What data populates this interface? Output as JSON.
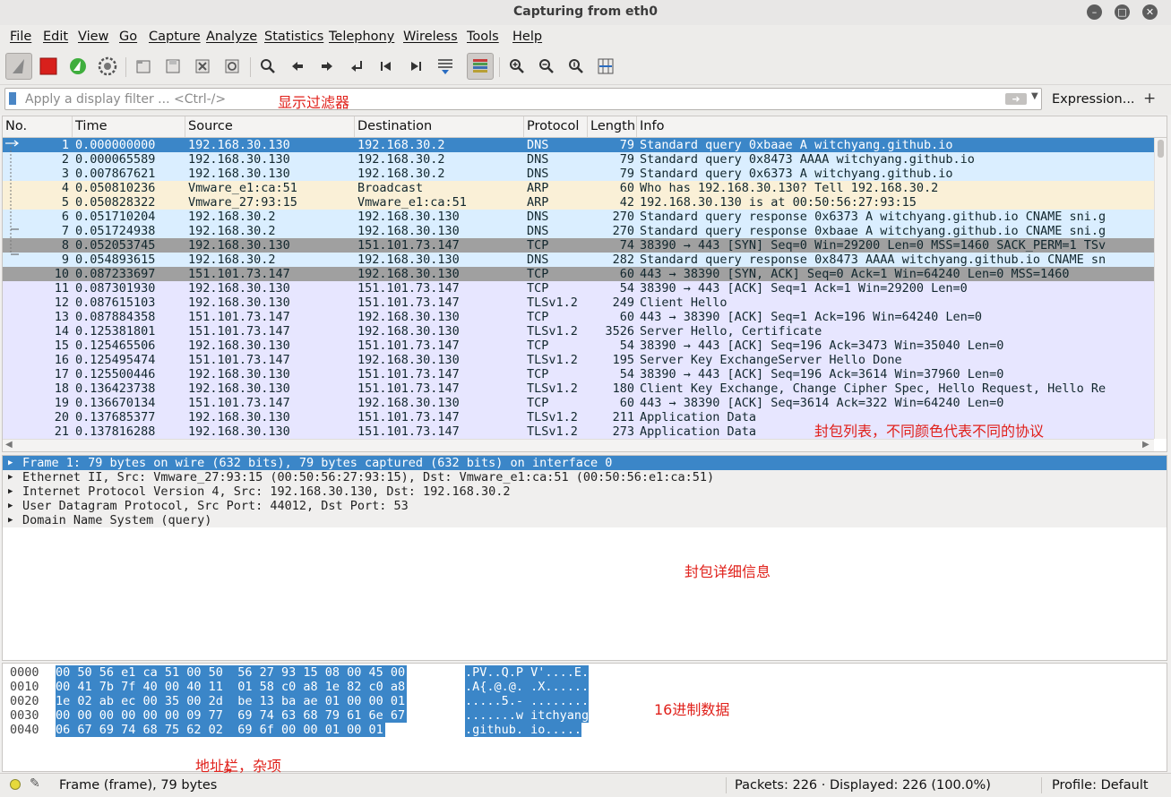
{
  "window": {
    "title": "Capturing from eth0",
    "controls": [
      "minimize-icon",
      "maximize-icon",
      "close-icon"
    ]
  },
  "menubar": {
    "items": [
      "File",
      "Edit",
      "View",
      "Go",
      "Capture",
      "Analyze",
      "Statistics",
      "Telephony",
      "Wireless",
      "Tools",
      "Help"
    ]
  },
  "toolbar": {
    "icons": [
      "shark-fin-icon",
      "stop-capture-icon",
      "restart-capture-icon",
      "capture-options-icon",
      "open-file-icon",
      "save-file-icon",
      "close-file-icon",
      "reload-file-icon",
      "find-packet-icon",
      "go-back-icon",
      "go-forward-icon",
      "go-to-packet-icon",
      "first-packet-icon",
      "last-packet-icon",
      "autoscroll-icon",
      "colorize-icon",
      "zoom-in-icon",
      "zoom-out-icon",
      "normal-size-icon",
      "resize-columns-icon"
    ]
  },
  "filter": {
    "placeholder": "Apply a display filter ... <Ctrl-/>",
    "value": "",
    "expression_label": "Expression...",
    "plus_label": "+"
  },
  "annotations": {
    "filter": "显示过滤器",
    "packet_list": "封包列表，不同颜色代表不同的协议",
    "details": "封包详细信息",
    "hex": "16进制数据",
    "status": "地址栏，杂项"
  },
  "packet_list": {
    "columns": [
      "No.",
      "Time",
      "Source",
      "Destination",
      "Protocol",
      "Length",
      "Info"
    ],
    "colors": {
      "dns": "#daeeff",
      "arp": "#faf0d7",
      "tcp": "#e7e6ff",
      "tcp_syn": "#a0a0a0",
      "selected": "#3b86c8"
    },
    "rows": [
      {
        "no": "1",
        "time": "0.000000000",
        "src": "192.168.30.130",
        "dst": "192.168.30.2",
        "proto": "DNS",
        "len": "79",
        "info": "Standard query 0xbaae A witchyang.github.io",
        "color": "dns",
        "selected": true
      },
      {
        "no": "2",
        "time": "0.000065589",
        "src": "192.168.30.130",
        "dst": "192.168.30.2",
        "proto": "DNS",
        "len": "79",
        "info": "Standard query 0x8473 AAAA witchyang.github.io",
        "color": "dns"
      },
      {
        "no": "3",
        "time": "0.007867621",
        "src": "192.168.30.130",
        "dst": "192.168.30.2",
        "proto": "DNS",
        "len": "79",
        "info": "Standard query 0x6373 A witchyang.github.io",
        "color": "dns"
      },
      {
        "no": "4",
        "time": "0.050810236",
        "src": "Vmware_e1:ca:51",
        "dst": "Broadcast",
        "proto": "ARP",
        "len": "60",
        "info": "Who has 192.168.30.130? Tell 192.168.30.2",
        "color": "arp"
      },
      {
        "no": "5",
        "time": "0.050828322",
        "src": "Vmware_27:93:15",
        "dst": "Vmware_e1:ca:51",
        "proto": "ARP",
        "len": "42",
        "info": "192.168.30.130 is at 00:50:56:27:93:15",
        "color": "arp"
      },
      {
        "no": "6",
        "time": "0.051710204",
        "src": "192.168.30.2",
        "dst": "192.168.30.130",
        "proto": "DNS",
        "len": "270",
        "info": "Standard query response 0x6373 A witchyang.github.io CNAME sni.g",
        "color": "dns"
      },
      {
        "no": "7",
        "time": "0.051724938",
        "src": "192.168.30.2",
        "dst": "192.168.30.130",
        "proto": "DNS",
        "len": "270",
        "info": "Standard query response 0xbaae A witchyang.github.io CNAME sni.g",
        "color": "dns"
      },
      {
        "no": "8",
        "time": "0.052053745",
        "src": "192.168.30.130",
        "dst": "151.101.73.147",
        "proto": "TCP",
        "len": "74",
        "info": "38390 → 443 [SYN] Seq=0 Win=29200 Len=0 MSS=1460 SACK_PERM=1 TSv",
        "color": "tcp_syn"
      },
      {
        "no": "9",
        "time": "0.054893615",
        "src": "192.168.30.2",
        "dst": "192.168.30.130",
        "proto": "DNS",
        "len": "282",
        "info": "Standard query response 0x8473 AAAA witchyang.github.io CNAME sn",
        "color": "dns"
      },
      {
        "no": "10",
        "time": "0.087233697",
        "src": "151.101.73.147",
        "dst": "192.168.30.130",
        "proto": "TCP",
        "len": "60",
        "info": "443 → 38390 [SYN, ACK] Seq=0 Ack=1 Win=64240 Len=0 MSS=1460",
        "color": "tcp_syn"
      },
      {
        "no": "11",
        "time": "0.087301930",
        "src": "192.168.30.130",
        "dst": "151.101.73.147",
        "proto": "TCP",
        "len": "54",
        "info": "38390 → 443 [ACK] Seq=1 Ack=1 Win=29200 Len=0",
        "color": "tcp"
      },
      {
        "no": "12",
        "time": "0.087615103",
        "src": "192.168.30.130",
        "dst": "151.101.73.147",
        "proto": "TLSv1.2",
        "len": "249",
        "info": "Client Hello",
        "color": "tcp"
      },
      {
        "no": "13",
        "time": "0.087884358",
        "src": "151.101.73.147",
        "dst": "192.168.30.130",
        "proto": "TCP",
        "len": "60",
        "info": "443 → 38390 [ACK] Seq=1 Ack=196 Win=64240 Len=0",
        "color": "tcp"
      },
      {
        "no": "14",
        "time": "0.125381801",
        "src": "151.101.73.147",
        "dst": "192.168.30.130",
        "proto": "TLSv1.2",
        "len": "3526",
        "info": "Server Hello, Certificate",
        "color": "tcp"
      },
      {
        "no": "15",
        "time": "0.125465506",
        "src": "192.168.30.130",
        "dst": "151.101.73.147",
        "proto": "TCP",
        "len": "54",
        "info": "38390 → 443 [ACK] Seq=196 Ack=3473 Win=35040 Len=0",
        "color": "tcp"
      },
      {
        "no": "16",
        "time": "0.125495474",
        "src": "151.101.73.147",
        "dst": "192.168.30.130",
        "proto": "TLSv1.2",
        "len": "195",
        "info": "Server Key ExchangeServer Hello Done",
        "color": "tcp"
      },
      {
        "no": "17",
        "time": "0.125500446",
        "src": "192.168.30.130",
        "dst": "151.101.73.147",
        "proto": "TCP",
        "len": "54",
        "info": "38390 → 443 [ACK] Seq=196 Ack=3614 Win=37960 Len=0",
        "color": "tcp"
      },
      {
        "no": "18",
        "time": "0.136423738",
        "src": "192.168.30.130",
        "dst": "151.101.73.147",
        "proto": "TLSv1.2",
        "len": "180",
        "info": "Client Key Exchange, Change Cipher Spec, Hello Request, Hello Re",
        "color": "tcp"
      },
      {
        "no": "19",
        "time": "0.136670134",
        "src": "151.101.73.147",
        "dst": "192.168.30.130",
        "proto": "TCP",
        "len": "60",
        "info": "443 → 38390 [ACK] Seq=3614 Ack=322 Win=64240 Len=0",
        "color": "tcp"
      },
      {
        "no": "20",
        "time": "0.137685377",
        "src": "192.168.30.130",
        "dst": "151.101.73.147",
        "proto": "TLSv1.2",
        "len": "211",
        "info": "Application Data",
        "color": "tcp"
      },
      {
        "no": "21",
        "time": "0.137816288",
        "src": "192.168.30.130",
        "dst": "151.101.73.147",
        "proto": "TLSv1.2",
        "len": "273",
        "info": "Application Data",
        "color": "tcp"
      }
    ]
  },
  "details": {
    "rows": [
      {
        "text": "Frame 1: 79 bytes on wire (632 bits), 79 bytes captured (632 bits) on interface 0",
        "selected": true
      },
      {
        "text": "Ethernet II, Src: Vmware_27:93:15 (00:50:56:27:93:15), Dst: Vmware_e1:ca:51 (00:50:56:e1:ca:51)"
      },
      {
        "text": "Internet Protocol Version 4, Src: 192.168.30.130, Dst: 192.168.30.2"
      },
      {
        "text": "User Datagram Protocol, Src Port: 44012, Dst Port: 53"
      },
      {
        "text": "Domain Name System (query)"
      }
    ]
  },
  "hex": {
    "rows": [
      {
        "offset": "0000",
        "bytes": "00 50 56 e1 ca 51 00 50  56 27 93 15 08 00 45 00",
        "ascii": ".PV..Q.P V'....E."
      },
      {
        "offset": "0010",
        "bytes": "00 41 7b 7f 40 00 40 11  01 58 c0 a8 1e 82 c0 a8",
        "ascii": ".A{.@.@. .X......"
      },
      {
        "offset": "0020",
        "bytes": "1e 02 ab ec 00 35 00 2d  be 13 ba ae 01 00 00 01",
        "ascii": ".....5.- ........"
      },
      {
        "offset": "0030",
        "bytes": "00 00 00 00 00 00 09 77  69 74 63 68 79 61 6e 67",
        "ascii": ".......w itchyang"
      },
      {
        "offset": "0040",
        "bytes": "06 67 69 74 68 75 62 02  69 6f 00 00 01 00 01",
        "ascii": ".github. io....."
      }
    ]
  },
  "status": {
    "frame_info": "Frame (frame), 79 bytes",
    "packets": "Packets: 226 · Displayed: 226 (100.0%)",
    "profile": "Profile: Default"
  }
}
